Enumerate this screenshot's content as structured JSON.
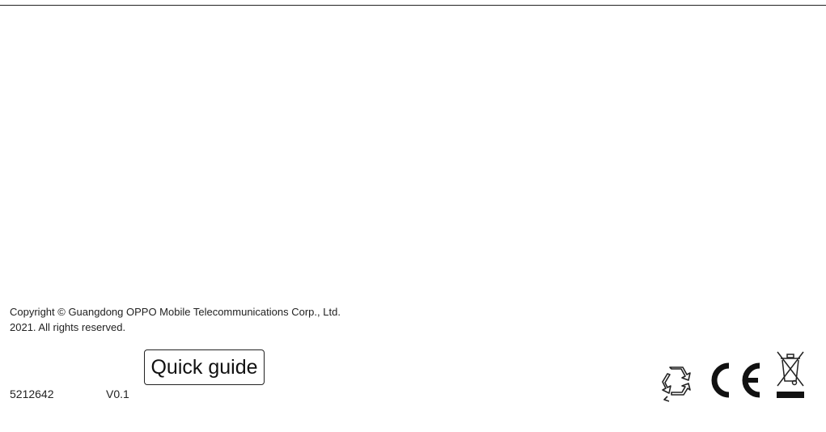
{
  "document": {
    "copyright_line1": "Copyright © Guangdong OPPO Mobile Telecommunications Corp., Ltd.",
    "copyright_line2": "2021. All rights reserved.",
    "part_number": "5212642",
    "version": "V0.1",
    "title_box": "Quick guide"
  },
  "marks": {
    "recycle": "recycle-icon",
    "ce": "ce-mark-icon",
    "weee": "weee-crossed-bin-icon"
  },
  "colors": {
    "ink": "#1a1a1a",
    "background": "#ffffff"
  }
}
